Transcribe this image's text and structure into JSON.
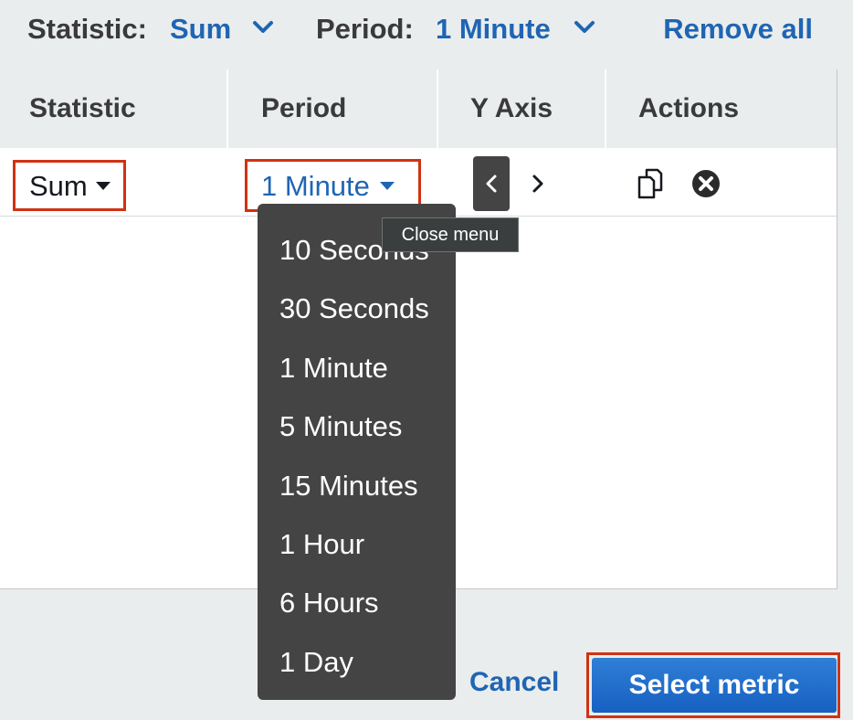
{
  "toolbar": {
    "statistic_label": "Statistic:",
    "statistic_value": "Sum",
    "period_label": "Period:",
    "period_value": "1 Minute",
    "remove_all": "Remove all"
  },
  "table": {
    "columns": [
      "Statistic",
      "Period",
      "Y Axis",
      "Actions"
    ],
    "row": {
      "statistic": "Sum",
      "period": "1 Minute"
    }
  },
  "tooltip": "Close menu",
  "period_menu": {
    "options": [
      "10 Seconds",
      "30 Seconds",
      "1 Minute",
      "5 Minutes",
      "15 Minutes",
      "1 Hour",
      "6 Hours",
      "1 Day"
    ]
  },
  "footer": {
    "cancel": "Cancel",
    "select_metric": "Select metric"
  },
  "colors": {
    "link": "#1f65b3",
    "highlight": "#d13212",
    "menu_bg": "#444444",
    "primary_button": "#1f6fcf"
  },
  "icons": [
    "chevron-down-icon",
    "chevron-left-icon",
    "chevron-right-icon",
    "copy-icon",
    "remove-circle-icon",
    "caret-down-icon"
  ]
}
